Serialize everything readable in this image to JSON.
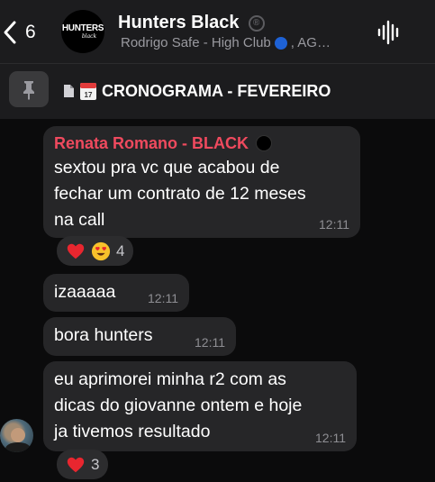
{
  "header": {
    "back_count": "6",
    "group_avatar": {
      "logo_main": "HUNTERS",
      "logo_sub": "black"
    },
    "title": "Hunters Black",
    "title_badge": "®",
    "subtitle_start": "Rodrigo Safe - High Club",
    "subtitle_end": ", AG…"
  },
  "pinned": {
    "title": "CRONOGRAMA - FEVEREIRO",
    "calendar_day": "17"
  },
  "messages": [
    {
      "sender": "Renata Romano - BLACK",
      "lines": [
        "sextou pra vc que acabou de",
        "fechar um contrato de 12 meses",
        "na call"
      ],
      "time": "12:11",
      "reaction_count": "4"
    },
    {
      "text": "izaaaaa",
      "time": "12:11"
    },
    {
      "text": "bora hunters",
      "time": "12:11"
    },
    {
      "lines": [
        "eu aprimorei minha r2 com as",
        "dicas do giovanne ontem e hoje",
        "ja tivemos resultado"
      ],
      "time": "12:11",
      "reaction_count": "3"
    }
  ],
  "colors": {
    "background": "#0b0b0c",
    "header_bg": "#1c1c1e",
    "bubble_bg": "#262628",
    "sender_name": "#ef4a5e",
    "timestamp": "#8e8e93",
    "channel_badge": "#1e62d6"
  },
  "icons": [
    "chevron-left-icon",
    "registered-icon",
    "blue-circle-icon",
    "voice-waveform-icon",
    "pin-icon",
    "document-icon",
    "calendar-icon",
    "black-circle-icon",
    "heart-icon",
    "heart-eyes-icon"
  ]
}
